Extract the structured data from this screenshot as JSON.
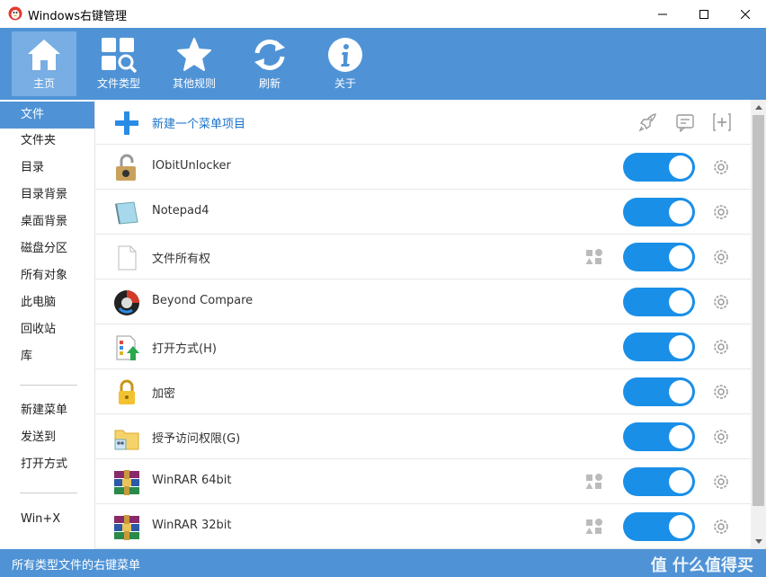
{
  "window": {
    "title": "Windows右键管理"
  },
  "toolbar": {
    "items": [
      {
        "label": "主页",
        "icon": "home-icon",
        "active": true
      },
      {
        "label": "文件类型",
        "icon": "grid-search-icon"
      },
      {
        "label": "其他规则",
        "icon": "star-icon"
      },
      {
        "label": "刷新",
        "icon": "refresh-icon"
      },
      {
        "label": "关于",
        "icon": "info-icon"
      }
    ]
  },
  "sidebar": {
    "items": [
      {
        "label": "文件",
        "active": true
      },
      {
        "label": "文件夹"
      },
      {
        "label": "目录"
      },
      {
        "label": "目录背景"
      },
      {
        "label": "桌面背景"
      },
      {
        "label": "磁盘分区"
      },
      {
        "label": "所有对象"
      },
      {
        "label": "此电脑"
      },
      {
        "label": "回收站"
      },
      {
        "label": "库"
      }
    ],
    "items2": [
      {
        "label": "新建菜单"
      },
      {
        "label": "发送到"
      },
      {
        "label": "打开方式"
      }
    ],
    "items3": [
      {
        "label": "Win+X"
      }
    ]
  },
  "main": {
    "new_item_label": "新建一个菜单项目",
    "rows": [
      {
        "label": "IObitUnlocker",
        "icon": "lock-open-icon",
        "enabled": true,
        "has_shape_icon": false
      },
      {
        "label": "Notepad4",
        "icon": "notepad-icon",
        "enabled": true,
        "has_shape_icon": false
      },
      {
        "label": "文件所有权",
        "icon": "blank-file-icon",
        "enabled": true,
        "has_shape_icon": true
      },
      {
        "label": "Beyond Compare",
        "icon": "beyond-compare-icon",
        "enabled": true,
        "has_shape_icon": false
      },
      {
        "label": "打开方式(H)",
        "icon": "open-with-icon",
        "enabled": true,
        "has_shape_icon": false
      },
      {
        "label": "加密",
        "icon": "padlock-icon",
        "enabled": true,
        "has_shape_icon": false
      },
      {
        "label": "授予访问权限(G)",
        "icon": "share-access-icon",
        "enabled": true,
        "has_shape_icon": false
      },
      {
        "label": "WinRAR 64bit",
        "icon": "winrar-icon",
        "enabled": true,
        "has_shape_icon": true
      },
      {
        "label": "WinRAR 32bit",
        "icon": "winrar-icon",
        "enabled": true,
        "has_shape_icon": true
      }
    ]
  },
  "status": {
    "text": "所有类型文件的右键菜单",
    "watermark": "值 什么值得买"
  },
  "colors": {
    "accent": "#4f93d6",
    "toggle": "#1a8fe8",
    "link": "#1a73c9"
  }
}
